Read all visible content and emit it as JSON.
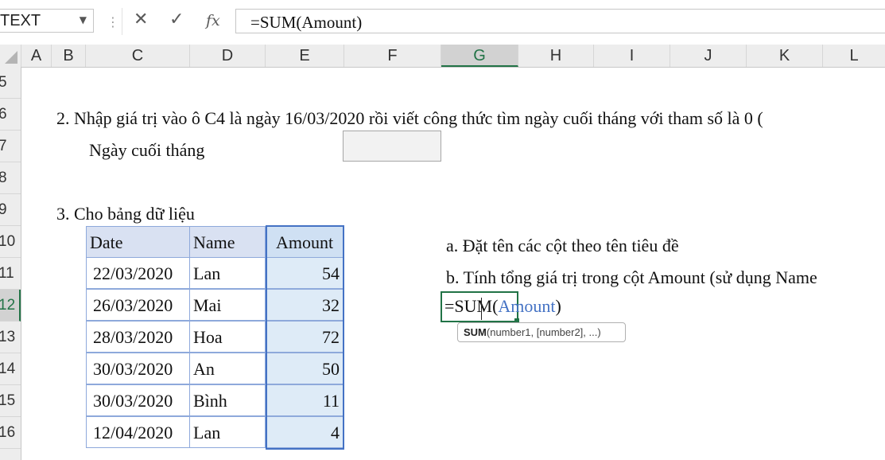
{
  "formula_bar": {
    "name_box": "TEXT",
    "sep": "⋮",
    "cancel": "✕",
    "enter": "✓",
    "fx": "fx",
    "formula": "=SUM(Amount)"
  },
  "columns": [
    "A",
    "B",
    "C",
    "D",
    "E",
    "F",
    "G",
    "H",
    "I",
    "J",
    "K",
    "L"
  ],
  "selected_column": "G",
  "rows": [
    "5",
    "6",
    "7",
    "8",
    "9",
    "10",
    "11",
    "12",
    "13",
    "14",
    "15",
    "16"
  ],
  "selected_row": "12",
  "sheet": {
    "task2": "2. Nhập giá trị vào ô C4 là ngày 16/03/2020 rồi viết công thức tìm ngày cuối tháng với tham số là 0 (",
    "c7_label": "Ngày cuối tháng",
    "task3": "3. Cho bảng dữ liệu",
    "task3a": "a. Đặt tên các cột theo tên tiêu đề",
    "task3b": "b. Tính tổng giá trị trong cột Amount (sử dụng Name"
  },
  "table": {
    "headers": [
      "Date",
      "Name",
      "Amount"
    ],
    "rows": [
      [
        "22/03/2020",
        "Lan",
        "54"
      ],
      [
        "26/03/2020",
        "Mai",
        "32"
      ],
      [
        "28/03/2020",
        "Hoa",
        "72"
      ],
      [
        "30/03/2020",
        "An",
        "50"
      ],
      [
        "30/03/2020",
        "Bình",
        "11"
      ],
      [
        "12/04/2020",
        "Lan",
        "4"
      ]
    ]
  },
  "edit_cell": {
    "prefix": "=SUM(",
    "ref": "Amount",
    "suffix": ")"
  },
  "tooltip": {
    "fn": "SUM",
    "args": "(number1, [number2], ...)"
  }
}
